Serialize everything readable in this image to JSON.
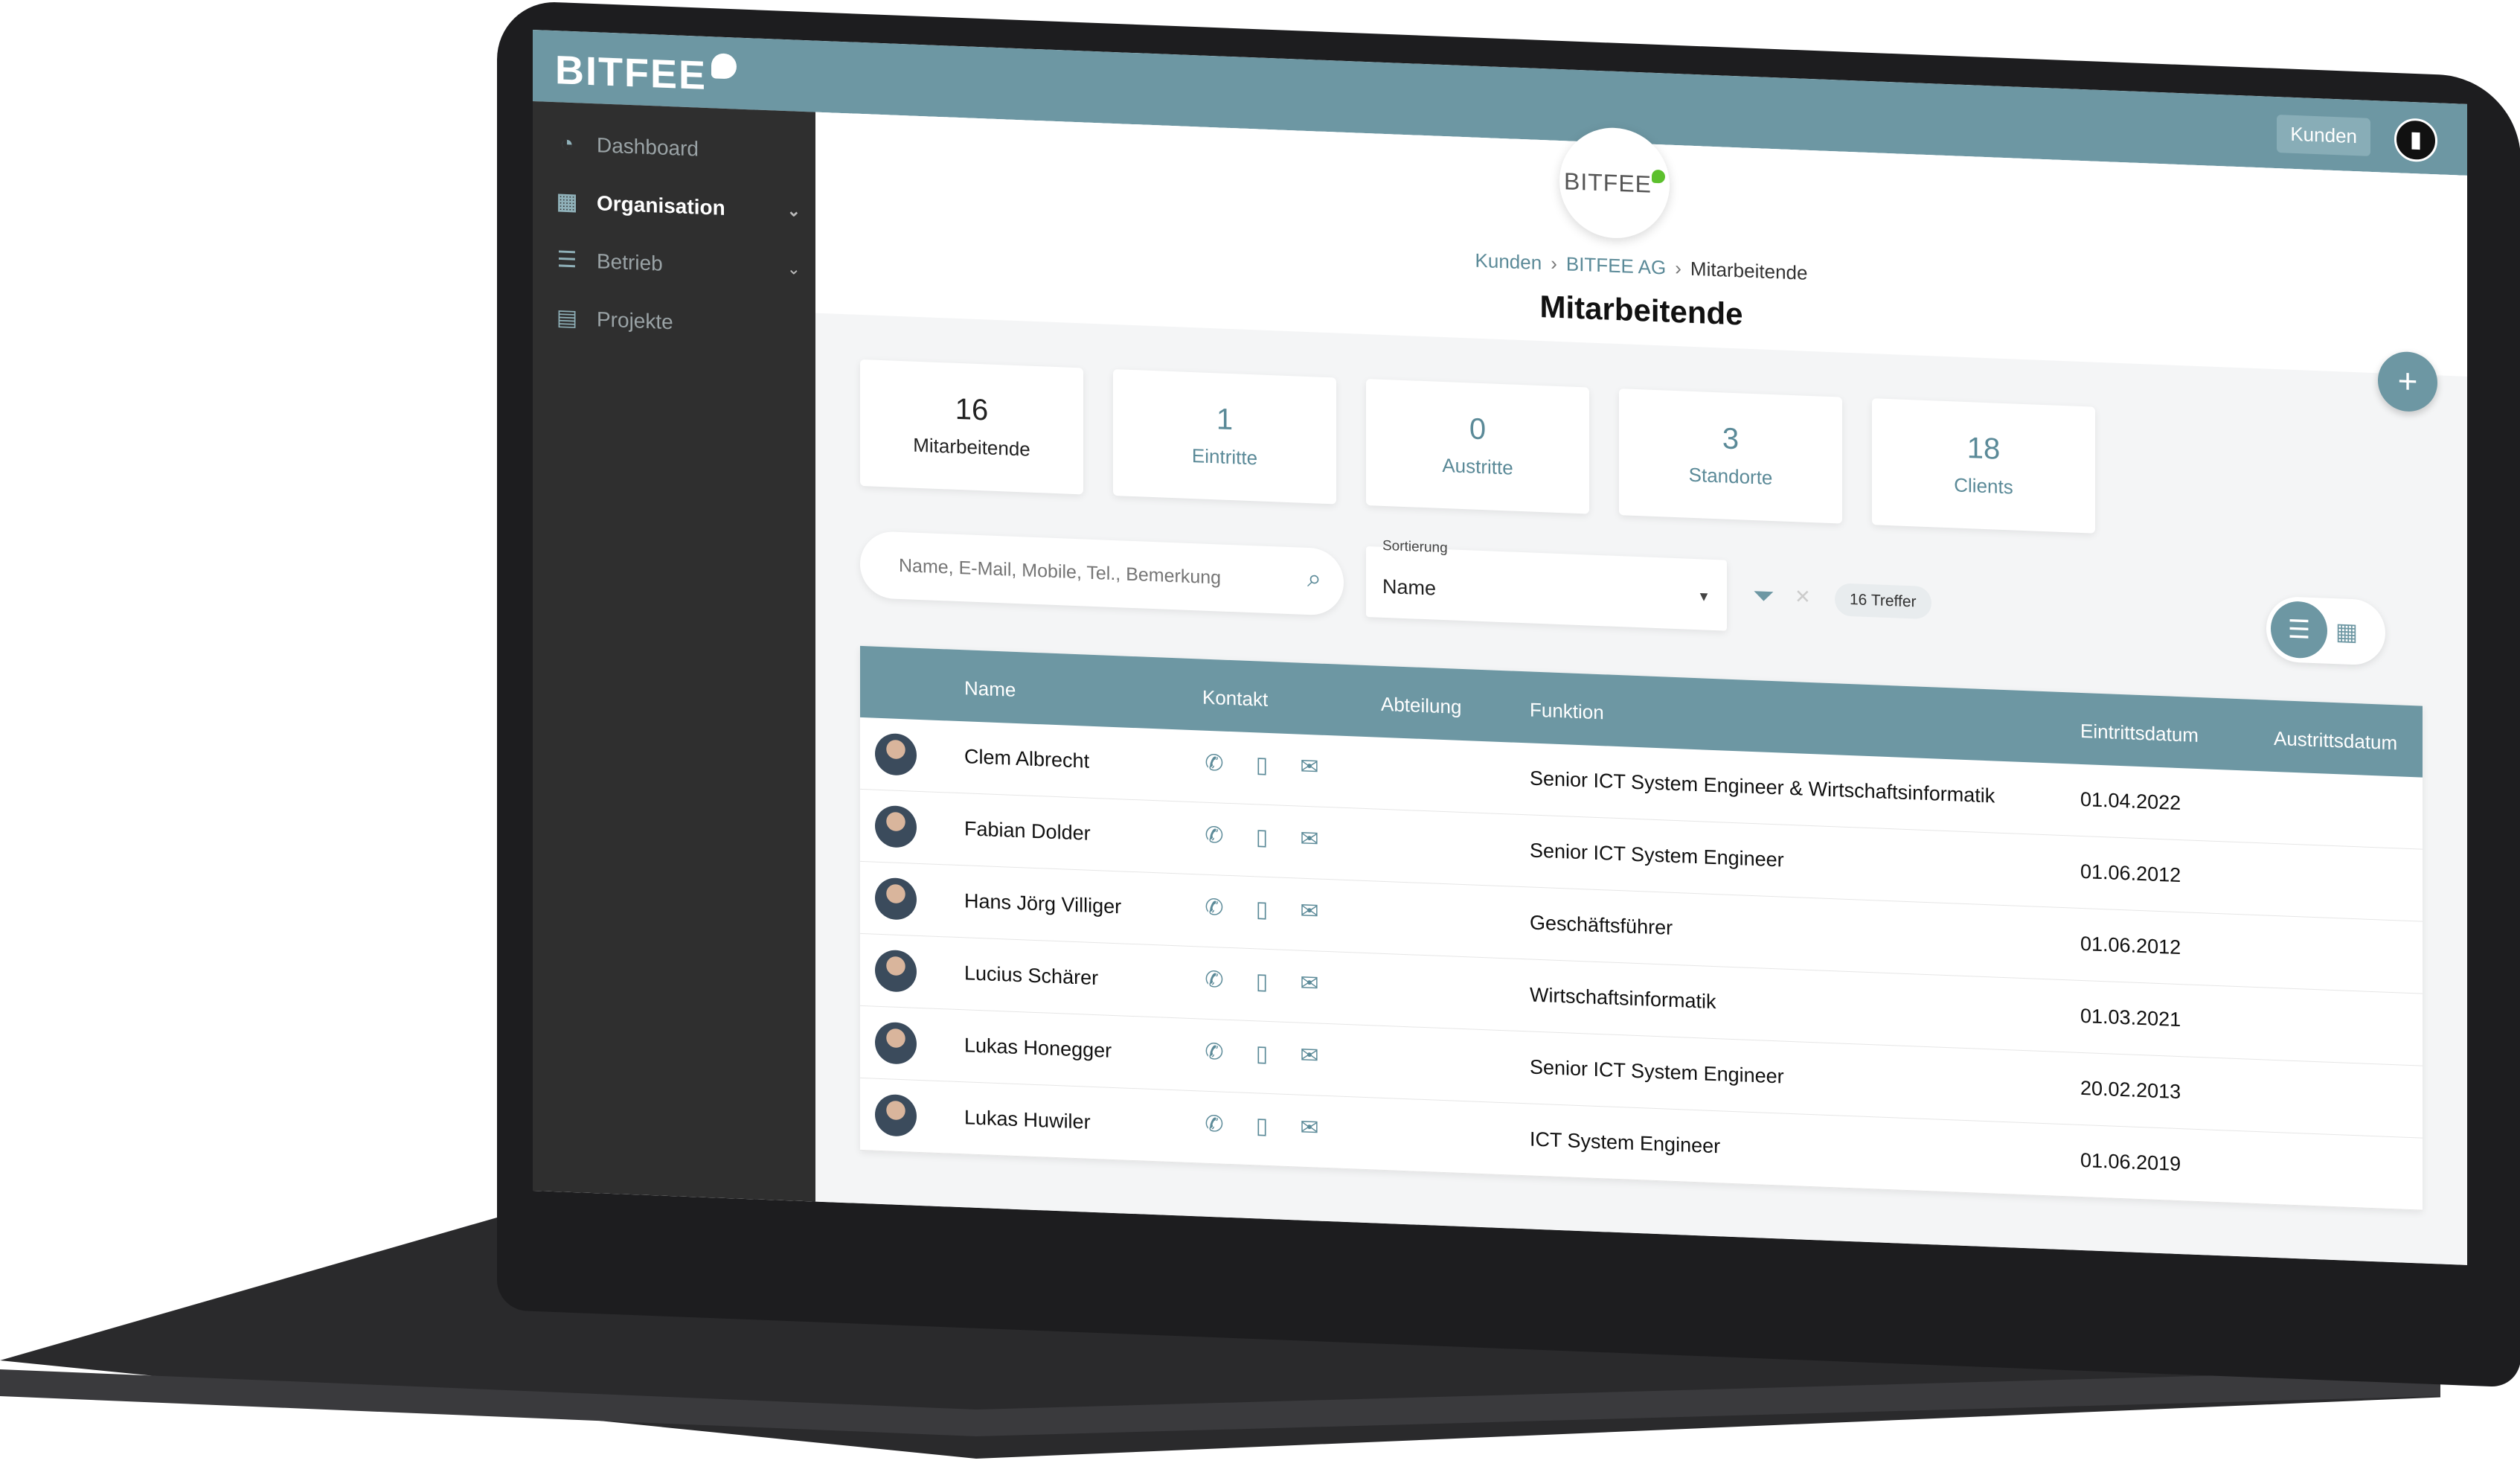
{
  "app": {
    "brand": "BITFEE",
    "kunden_button": "Kunden",
    "logo_text": "BITFEE"
  },
  "sidebar": {
    "items": [
      {
        "label": "Dashboard",
        "icon": "pie-chart-icon"
      },
      {
        "label": "Organisation",
        "icon": "building-icon"
      },
      {
        "label": "Betrieb",
        "icon": "list-icon"
      },
      {
        "label": "Projekte",
        "icon": "clipboard-icon"
      }
    ]
  },
  "breadcrumb": {
    "items": [
      "Kunden",
      "BITFEE AG",
      "Mitarbeitende"
    ],
    "separator": "›"
  },
  "page": {
    "title": "Mitarbeitende"
  },
  "stats": [
    {
      "value": "16",
      "label": "Mitarbeitende"
    },
    {
      "value": "1",
      "label": "Eintritte"
    },
    {
      "value": "0",
      "label": "Austritte"
    },
    {
      "value": "3",
      "label": "Standorte"
    },
    {
      "value": "18",
      "label": "Clients"
    }
  ],
  "filters": {
    "search_placeholder": "Name, E-Mail, Mobile, Tel., Bemerkung",
    "sort_label": "Sortierung",
    "sort_value": "Name",
    "hits": "16 Treffer"
  },
  "table": {
    "headers": {
      "name": "Name",
      "contact": "Kontakt",
      "department": "Abteilung",
      "function": "Funktion",
      "entry": "Eintrittsdatum",
      "exit": "Austrittsdatum"
    },
    "rows": [
      {
        "name": "Clem Albrecht",
        "function": "Senior ICT System Engineer & Wirtschaftsinformatik",
        "entry": "01.04.2022"
      },
      {
        "name": "Fabian Dolder",
        "function": "Senior ICT System Engineer",
        "entry": "01.06.2012"
      },
      {
        "name": "Hans Jörg Villiger",
        "function": "Geschäftsführer",
        "entry": "01.06.2012"
      },
      {
        "name": "Lucius Schärer",
        "function": "Wirtschaftsinformatik",
        "entry": "01.03.2021"
      },
      {
        "name": "Lukas Honegger",
        "function": "Senior ICT System Engineer",
        "entry": "20.02.2013"
      },
      {
        "name": "Lukas Huwiler",
        "function": "ICT System Engineer",
        "entry": "01.06.2019"
      }
    ]
  },
  "colors": {
    "accent": "#6d97a3",
    "sidebar_bg": "#2f2f2f",
    "leaf_green": "#5cc02d"
  }
}
